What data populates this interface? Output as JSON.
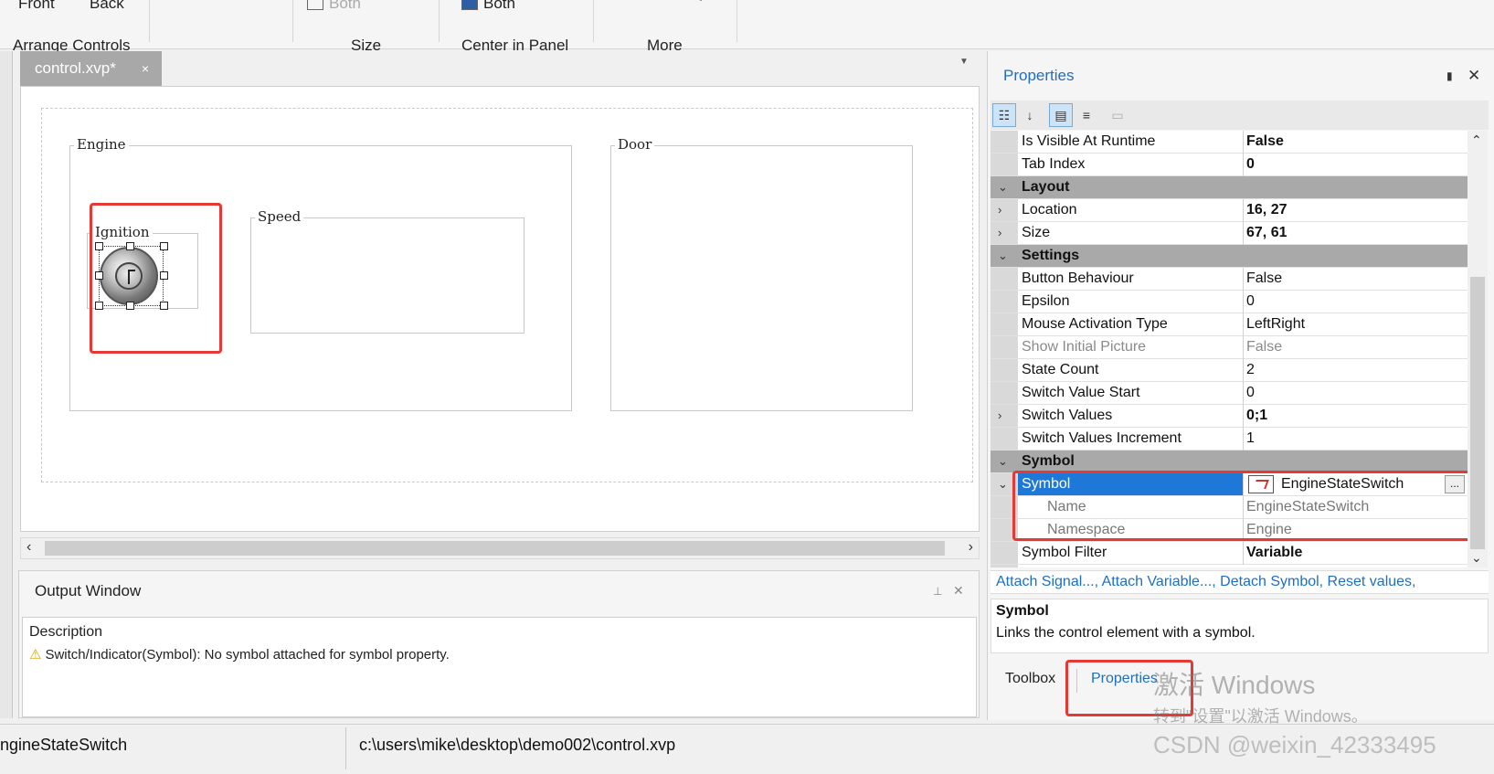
{
  "ribbon": {
    "front_label": "Front",
    "back_label": "Back",
    "both_size_label": "Both",
    "both_center_label": "Both",
    "groups": {
      "arrange": "Arrange Controls",
      "size": "Size",
      "center": "Center in Panel",
      "more": "More"
    }
  },
  "document": {
    "tab_label": "control.xvp*",
    "tab_close": "×",
    "groups": {
      "engine": "Engine",
      "door": "Door",
      "ignition": "Ignition",
      "speed": "Speed"
    }
  },
  "output": {
    "title": "Output Window",
    "column": "Description",
    "message": "Switch/Indicator(Symbol): No symbol attached for symbol property."
  },
  "properties": {
    "title": "Properties",
    "rows": [
      {
        "name": "Is Visible At Runtime",
        "value": "False"
      },
      {
        "name": "Tab Index",
        "value": "0"
      },
      {
        "name": "Layout",
        "value": ""
      },
      {
        "name": "Location",
        "value": "16, 27"
      },
      {
        "name": "Size",
        "value": "67, 61"
      },
      {
        "name": "Settings",
        "value": ""
      },
      {
        "name": "Button Behaviour",
        "value": "False"
      },
      {
        "name": "Epsilon",
        "value": "0"
      },
      {
        "name": "Mouse Activation Type",
        "value": "LeftRight"
      },
      {
        "name": "Show Initial Picture",
        "value": "False"
      },
      {
        "name": "State Count",
        "value": "2"
      },
      {
        "name": "Switch Value Start",
        "value": "0"
      },
      {
        "name": "Switch Values",
        "value": "0;1"
      },
      {
        "name": "Switch Values Increment",
        "value": "1"
      },
      {
        "name": "Symbol",
        "value": ""
      },
      {
        "name": "Symbol",
        "value": "EngineStateSwitch"
      },
      {
        "name": "Name",
        "value": "EngineStateSwitch"
      },
      {
        "name": "Namespace",
        "value": "Engine"
      },
      {
        "name": "Symbol Filter",
        "value": "Variable"
      }
    ],
    "commands": "Attach Signal..., Attach Variable..., Detach Symbol, Reset values,",
    "desc_title": "Symbol",
    "desc_text": "Links the control element with a symbol.",
    "ellipsis": "...",
    "tabs": {
      "toolbox": "Toolbox",
      "properties": "Properties"
    }
  },
  "statusbar": {
    "left": "ngineStateSwitch",
    "path": "c:\\users\\mike\\desktop\\demo002\\control.xvp"
  },
  "watermark": {
    "line1": "激活 Windows",
    "line2": "转到\"设置\"以激活 Windows。",
    "line3": "CSDN @weixin_42333495"
  },
  "colors": {
    "accent": "#1e78d7",
    "highlight_red": "#e53935",
    "category_bg": "#a9a9a9"
  }
}
